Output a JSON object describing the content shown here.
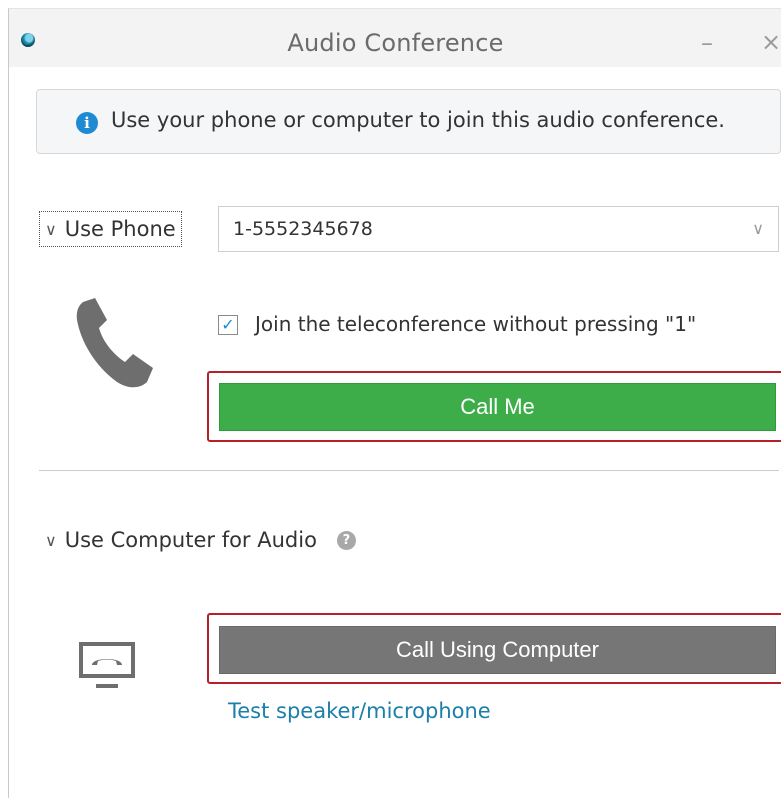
{
  "window": {
    "title": "Audio Conference",
    "minimize_glyph": "–",
    "close_glyph": "×"
  },
  "info": {
    "text": "Use your phone or computer to join this audio conference.",
    "icon": "info-icon",
    "icon_glyph": "i",
    "color": "#1f8ad2"
  },
  "phone_section": {
    "toggle_label": "Use Phone",
    "expanded": true,
    "selected_number": "1-5552345678",
    "checkbox_label": "Join the teleconference without pressing \"1\"",
    "checkbox_checked": true,
    "check_glyph": "✓",
    "call_button_label": "Call Me",
    "call_button_color": "#3cad48",
    "icon": "phone-handset-icon"
  },
  "computer_section": {
    "toggle_label": "Use Computer for Audio",
    "expanded": true,
    "help_glyph": "?",
    "call_button_label": "Call Using Computer",
    "call_button_color": "#767676",
    "test_link_label": "Test speaker/microphone",
    "icon": "computer-audio-icon"
  },
  "highlight_color": "#b5202b"
}
